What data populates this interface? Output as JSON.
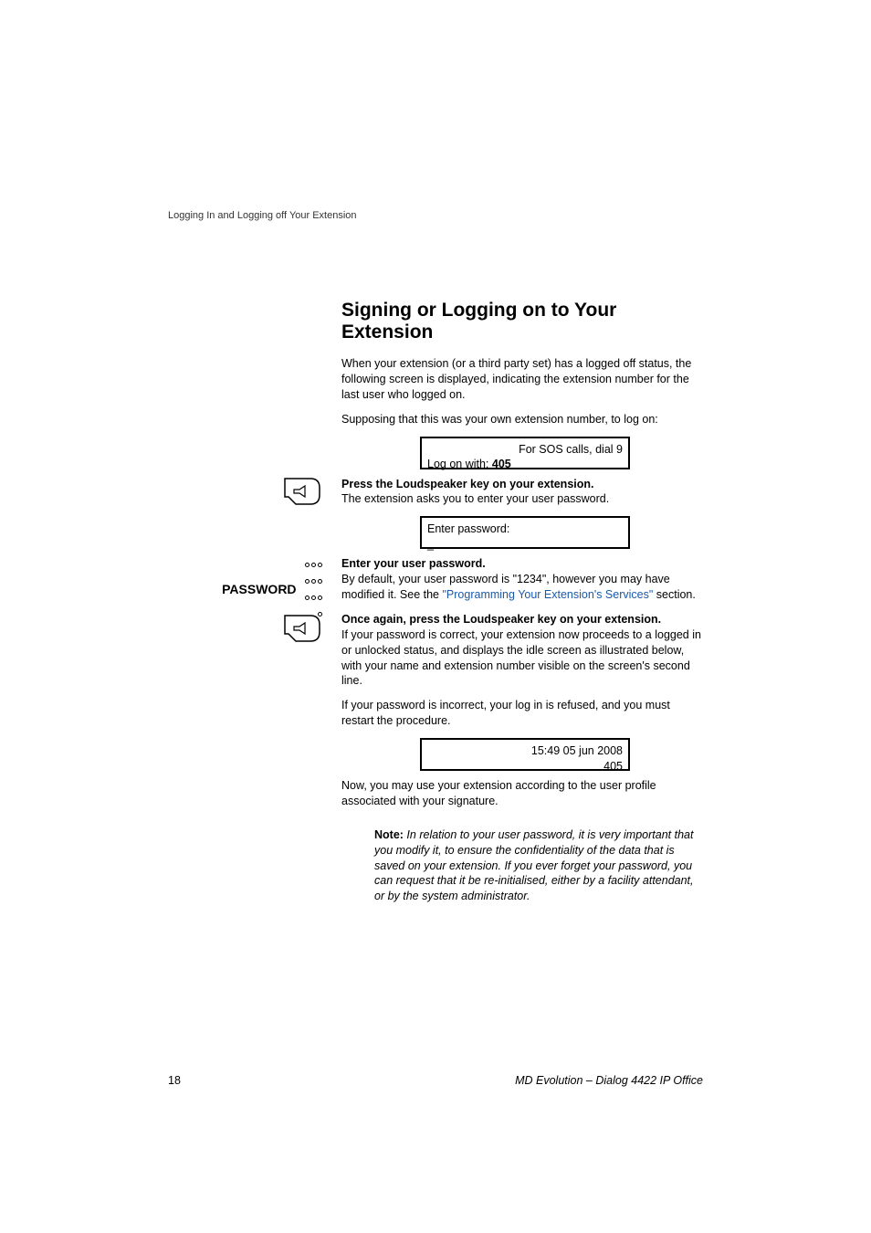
{
  "running_head": "Logging In and Logging off Your Extension",
  "section_title": "Signing or Logging on to Your Extension",
  "p1": "When your extension (or a third party set) has a logged off status, the following screen is displayed, indicating the extension number for the last user who logged on.",
  "p2": "Supposing that this was your own extension number, to log on:",
  "lcd1": {
    "line1": "For SOS calls, dial 9",
    "line2a": "Log on with:  ",
    "line2b": "405"
  },
  "step1_bold": "Press the Loudspeaker key on your extension.",
  "step1_text": "The extension asks you to enter your user password.",
  "lcd2": {
    "line1": "Enter  password:",
    "line2": "_"
  },
  "password_label": "PASSWORD",
  "step2_bold": "Enter your user password.",
  "step2_text_a": "By default, your user password is \"1234\", however you may have modified it. See the ",
  "step2_link": "\"Programming Your Extension's Services\"",
  "step2_text_b": " section.",
  "step3_bold": "Once again, press the Loudspeaker key on your extension.",
  "step3_text": "If your password is correct, your extension now proceeds to a logged in or unlocked status, and displays the idle screen as illustrated below, with your name and extension number visible on the screen's second line.",
  "step3_text2": "If your password is incorrect, your log in is refused, and you must restart the procedure.",
  "lcd3": {
    "line1": "15:49   05  jun  2008",
    "line2": "405"
  },
  "p_after": "Now, you may use your extension according to the user profile associated with your signature.",
  "note_label": "Note:",
  "note_body": "  In relation to your user password, it is very important that you modify it, to ensure the confidentiality of the data that is saved on your extension. If you ever forget your password, you can request that it be re-initialised, either by a facility attendant, or by the system administrator.",
  "footer": {
    "page": "18",
    "doc": "MD Evolution – Dialog 4422 IP Office"
  }
}
